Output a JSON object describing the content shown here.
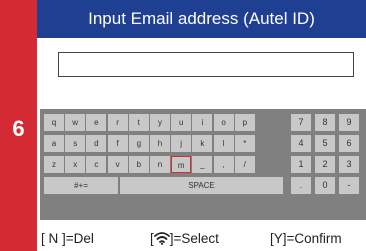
{
  "colors": {
    "accent_red": "#d42a33",
    "title_blue": "#1f3f93",
    "keyboard_bg": "#808080",
    "key_bg": "#c8c8c8"
  },
  "step_number": "6",
  "title": "Input Email address (Autel ID)",
  "email_input": {
    "value": ""
  },
  "keyboard": {
    "rows": [
      [
        "q",
        "w",
        "e",
        "r",
        "t",
        "y",
        "u",
        "i",
        "o",
        "p"
      ],
      [
        "a",
        "s",
        "d",
        "f",
        "g",
        "h",
        "j",
        "k",
        "l",
        "*"
      ],
      [
        "z",
        "x",
        "c",
        "v",
        "b",
        "n",
        "m",
        "_",
        ",",
        "/"
      ]
    ],
    "numpad": [
      [
        "7",
        "8",
        "9"
      ],
      [
        "4",
        "5",
        "6"
      ],
      [
        "1",
        "2",
        "3"
      ],
      [
        ".",
        "0",
        "-"
      ]
    ],
    "symbols_key": "#+=",
    "space_key": "SPACE",
    "selected_key": "m"
  },
  "hints": {
    "delete": "[ N ]=Del",
    "select_prefix": "[",
    "select": "]=Select",
    "confirm": "[Y]=Confirm",
    "select_icon": "wifi-icon"
  }
}
